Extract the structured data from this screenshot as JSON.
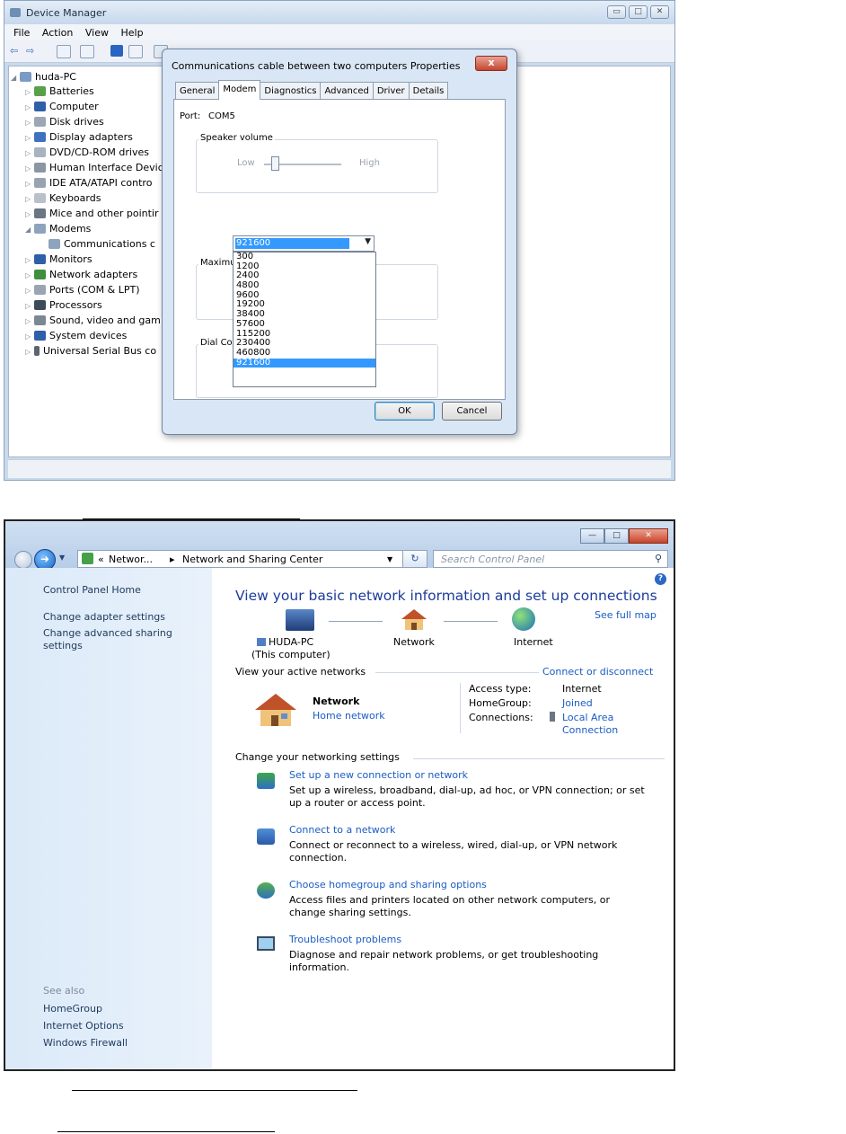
{
  "device_manager": {
    "title": "Device Manager",
    "menu": [
      "File",
      "Action",
      "View",
      "Help"
    ],
    "tree": {
      "root": "huda-PC",
      "items": [
        "Batteries",
        "Computer",
        "Disk drives",
        "Display adapters",
        "DVD/CD-ROM drives",
        "Human Interface Devic",
        "IDE ATA/ATAPI contro",
        "Keyboards",
        "Mice and other pointir",
        "Modems",
        "Communications c",
        "Monitors",
        "Network adapters",
        "Ports (COM & LPT)",
        "Processors",
        "Sound, video and gam",
        "System devices",
        "Universal Serial Bus co"
      ]
    }
  },
  "properties_dialog": {
    "title": "Communications cable between two computers Properties",
    "close_label": "x",
    "tabs": [
      "General",
      "Modem",
      "Diagnostics",
      "Advanced",
      "Driver",
      "Details"
    ],
    "active_tab": "Modem",
    "port_label": "Port:",
    "port_value": "COM5",
    "speaker_volume_label": "Speaker volume",
    "low_label": "Low",
    "high_label": "High",
    "max_port_speed_label": "Maximum Port Speed",
    "selected_speed": "921600",
    "speed_options": [
      "300",
      "1200",
      "2400",
      "4800",
      "9600",
      "19200",
      "38400",
      "57600",
      "115200",
      "230400",
      "460800",
      "921600"
    ],
    "dial_control_label": "Dial Cont",
    "ok_label": "OK",
    "cancel_label": "Cancel"
  },
  "network_center": {
    "address": {
      "chevron": "«",
      "crumb1": "Networ...",
      "separator": "▸",
      "crumb2": "Network and Sharing Center"
    },
    "search_placeholder": "Search Control Panel",
    "sidebar": {
      "home": "Control Panel Home",
      "links": [
        "Change adapter settings",
        "Change advanced sharing settings"
      ],
      "see_also_label": "See also",
      "see_also": [
        "HomeGroup",
        "Internet Options",
        "Windows Firewall"
      ]
    },
    "heading": "View your basic network information and set up connections",
    "see_full_map": "See full map",
    "map": {
      "computer": "HUDA-PC",
      "computer_sub": "(This computer)",
      "network": "Network",
      "internet": "Internet"
    },
    "active_networks_label": "View your active networks",
    "connect_disconnect": "Connect or disconnect",
    "active_network": {
      "name": "Network",
      "type": "Home network",
      "access_type_label": "Access type:",
      "access_type_value": "Internet",
      "homegroup_label": "HomeGroup:",
      "homegroup_value": "Joined",
      "connections_label": "Connections:",
      "connections_value_1": "Local Area",
      "connections_value_2": "Connection"
    },
    "change_settings_label": "Change your networking settings",
    "tasks": [
      {
        "title": "Set up a new connection or network",
        "desc1": "Set up a wireless, broadband, dial-up, ad hoc, or VPN connection; or set",
        "desc2": "up a router or access point."
      },
      {
        "title": "Connect to a network",
        "desc1": "Connect or reconnect to a wireless, wired, dial-up, or VPN network",
        "desc2": "connection."
      },
      {
        "title": "Choose homegroup and sharing options",
        "desc1": "Access files and printers located on other network computers, or",
        "desc2": "change sharing settings."
      },
      {
        "title": "Troubleshoot problems",
        "desc1": "Diagnose and repair network problems, or get troubleshooting",
        "desc2": "information."
      }
    ]
  },
  "colors": {
    "link_blue": "#1a5cc4",
    "heading_blue": "#1c3c9c",
    "selection_blue": "#3399ff"
  }
}
